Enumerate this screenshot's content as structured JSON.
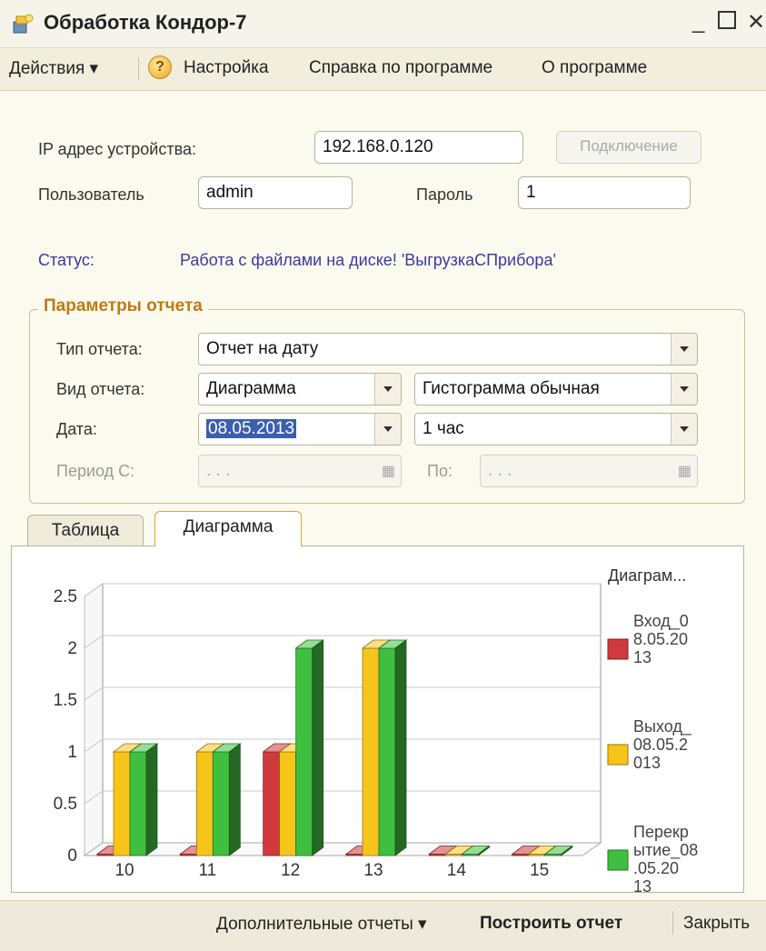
{
  "window": {
    "title": "Обработка  Кондор-7"
  },
  "menu": {
    "actions": "Действия ▾",
    "settings": "Настройка",
    "help": "Справка по программе",
    "about": "О программе"
  },
  "connection": {
    "ip_label": "IP адрес устройства:",
    "ip_value": "192.168.0.120",
    "connect_button": "Подключение",
    "user_label": "Пользователь",
    "user_value": "admin",
    "password_label": "Пароль",
    "password_value": "1",
    "status_label": "Статус:",
    "status_value": "Работа с файлами на диске! 'ВыгрузкаСПрибора'"
  },
  "report": {
    "group_title": "Параметры отчета",
    "type_label": "Тип отчета:",
    "type_value": "Отчет на дату",
    "kind_label": "Вид отчета:",
    "kind_value": "Диаграмма",
    "chart_kind_value": "Гистограмма обычная",
    "date_label": "Дата:",
    "date_value": "08.05.2013",
    "interval_value": "1 час",
    "period_from_label": "Период С:",
    "period_from_value": ". . .",
    "period_to_label": "По:",
    "period_to_value": ". . ."
  },
  "tabs": [
    {
      "label": "Таблица"
    },
    {
      "label": "Диаграмма"
    }
  ],
  "footer": {
    "extra_reports": "Дополнительные отчеты ▾",
    "build_report": "Построить отчет",
    "close": "Закрыть"
  },
  "colors": {
    "series_red": "#d0393d",
    "series_yellow": "#f7c51a",
    "series_green": "#3fbf3f"
  },
  "chart_data": {
    "type": "bar",
    "title": "Диаграм...",
    "categories": [
      "10",
      "11",
      "12",
      "13",
      "14",
      "15"
    ],
    "series": [
      {
        "name": "Вход_08.05.2013",
        "values": [
          0,
          0,
          1,
          0,
          0,
          0
        ]
      },
      {
        "name": "Выход_08.05.2013",
        "values": [
          1,
          1,
          1,
          2,
          0,
          0
        ]
      },
      {
        "name": "Перекрытие_08.05.2013",
        "values": [
          1,
          1,
          2,
          2,
          0,
          0
        ]
      }
    ],
    "yticks": [
      "0",
      "0.5",
      "1",
      "1.5",
      "2",
      "2.5"
    ],
    "ylim": [
      0,
      2.5
    ],
    "grid": true,
    "legend": "right"
  }
}
